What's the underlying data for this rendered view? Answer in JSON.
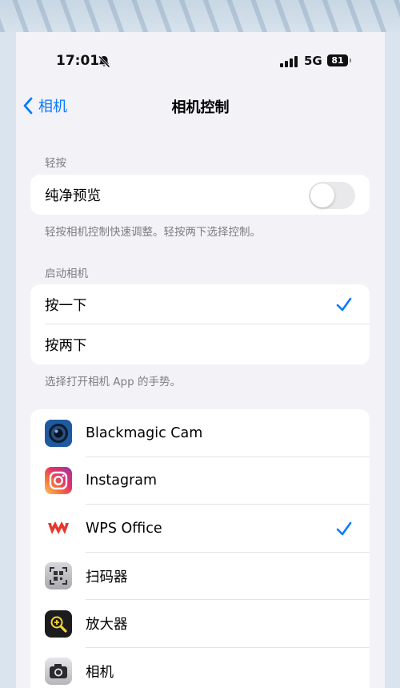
{
  "status": {
    "time": "17:01",
    "network": "5G",
    "battery": "81"
  },
  "nav": {
    "back_label": "相机",
    "title": "相机控制"
  },
  "tap_section": {
    "header": "轻按",
    "clean_preview_label": "纯净预览",
    "clean_preview_on": false,
    "footer": "轻按相机控制快速调整。轻按两下选择控制。"
  },
  "launch_section": {
    "header": "启动相机",
    "options": [
      {
        "label": "按一下",
        "selected": true
      },
      {
        "label": "按两下",
        "selected": false
      }
    ],
    "footer": "选择打开相机 App 的手势。"
  },
  "apps": [
    {
      "name": "Blackmagic Cam",
      "icon": "blackmagic-cam-icon",
      "selected": false
    },
    {
      "name": "Instagram",
      "icon": "instagram-icon",
      "selected": false
    },
    {
      "name": "WPS Office",
      "icon": "wps-office-icon",
      "selected": true
    },
    {
      "name": "扫码器",
      "icon": "code-scanner-icon",
      "selected": false
    },
    {
      "name": "放大器",
      "icon": "magnifier-icon",
      "selected": false
    },
    {
      "name": "相机",
      "icon": "camera-icon",
      "selected": false
    }
  ],
  "colors": {
    "accent": "#0a7aff",
    "background": "#f2f2f7",
    "toggle_off": "#e9e9eb",
    "wps_red": "#e8372c"
  }
}
